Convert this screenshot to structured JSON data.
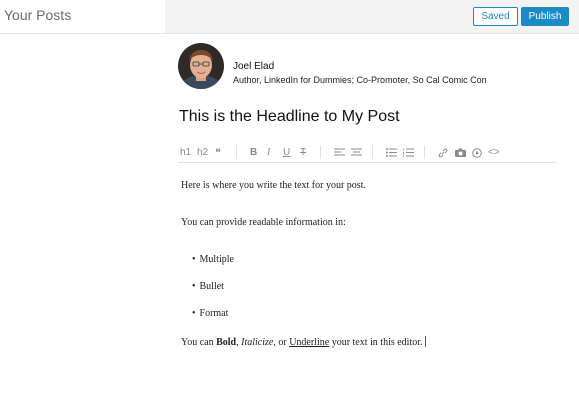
{
  "sidebar": {
    "title": "Your Posts"
  },
  "topbar": {
    "saved_label": "Saved",
    "publish_label": "Publish"
  },
  "author": {
    "name": "Joel Elad",
    "title": "Author, LinkedIn for Dummies; Co-Promoter, So Cal Comic Con"
  },
  "post": {
    "headline": "This is the Headline to My Post",
    "paragraph1": "Here is where you write the text for your post.",
    "paragraph2": "You can provide readable information in:",
    "bullets": [
      "Multiple",
      "Bullet",
      "Format"
    ],
    "last_line": {
      "prefix": "You can ",
      "bold": "Bold",
      "comma": ", ",
      "italic": "Italicize",
      "or": ", or ",
      "underline": "Underline",
      "suffix": " your text in this editor."
    }
  },
  "toolbar": {
    "h1": "h1",
    "h2": "h2",
    "quote": "❝",
    "bold": "B",
    "italic": "I",
    "underline": "U",
    "strike": "T",
    "code": "<>"
  },
  "colors": {
    "accent": "#1a8bc4",
    "topbar_bg": "#f3f3f3"
  }
}
